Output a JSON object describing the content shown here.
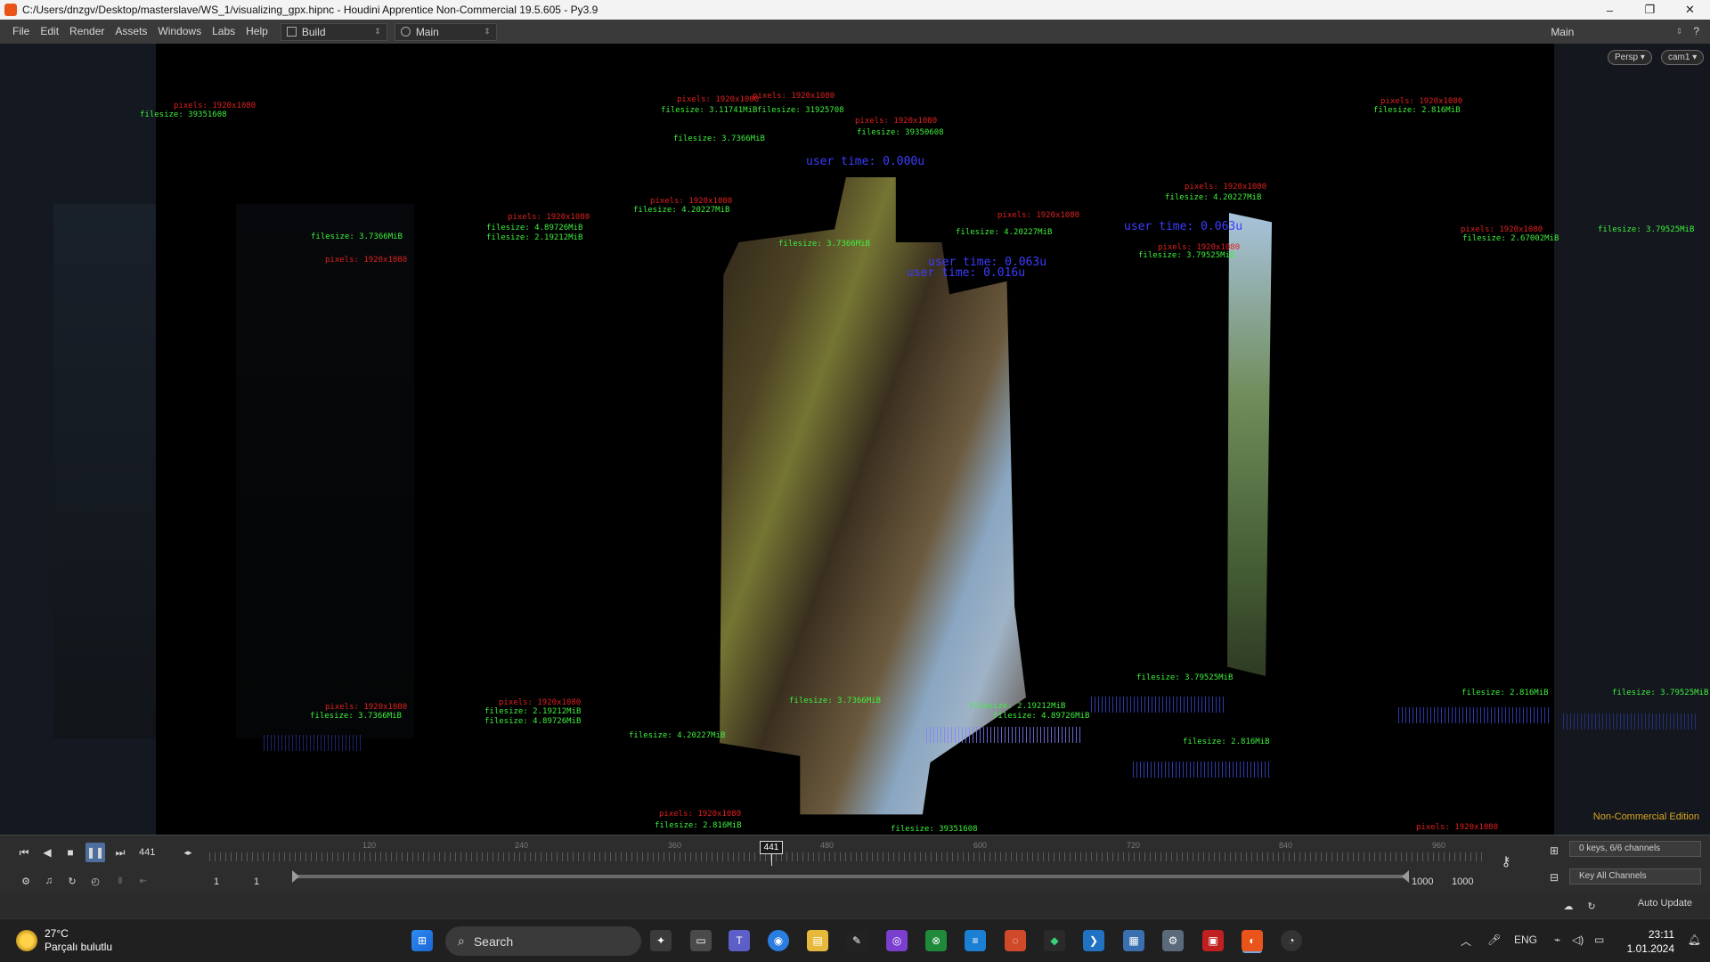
{
  "window": {
    "title": "C:/Users/dnzgv/Desktop/masterslave/WS_1/visualizing_gpx.hipnc - Houdini Apprentice Non-Commercial 19.5.605 - Py3.9",
    "minimize": "–",
    "maximize": "❐",
    "close": "✕"
  },
  "menu": {
    "items": [
      "File",
      "Edit",
      "Render",
      "Assets",
      "Windows",
      "Labs",
      "Help"
    ],
    "desktop_select": "Build",
    "desktop_select2": "Main",
    "right_desktop": "Main"
  },
  "viewport": {
    "persp_button": "Persp ▾",
    "cam_button": "cam1 ▾",
    "non_commercial": "Non-Commercial Edition",
    "labels_red": [
      "pixels: 1920x1080",
      "pixels: 1920x1080",
      "pixels: 1920x1080",
      "pixels: 1920x1080",
      "pixels: 1920x1080",
      "pixels: 1920x1080",
      "pixels: 1920x1080",
      "pixels: 1920x1080",
      "pixels: 1920x1080",
      "pixels: 1920x1080",
      "pixels: 1920x1080",
      "pixels: 1920x1080",
      "pixels: 1920x1080",
      "pixels: 1920x1080",
      "pixels: 1920x1080",
      "pixels: 1920x1080"
    ],
    "labels_green": [
      "filesize: 39351608",
      "filesize: 3.11741MiB",
      "filesize: 31925708",
      "filesize: 2.816MiB",
      "filesize: 3.7366MiB",
      "filesize: 4.89726MiB",
      "filesize: 2.19212MiB",
      "filesize: 4.20227MiB",
      "filesize: 3.7366MiB",
      "filesize: 39350608",
      "filesize: 2.816MiB",
      "filesize: 4.20227MiB",
      "filesize: 3.79525MiB",
      "filesize: 3.7366MiB",
      "filesize: 2.19212MiB",
      "filesize: 4.89726MiB",
      "filesize: 4.20227MiB",
      "filesize: 3.7366MiB",
      "filesize: 2.19212MiB",
      "filesize: 4.89726MiB",
      "filesize: 3.79525MiB",
      "filesize: 4.20227MiB",
      "filesize: 2.816MiB",
      "filesize: 39351608",
      "filesize: 3.79525MiB",
      "filesize: 2.67002MiB"
    ],
    "user_time_1": "user time: 0.063u",
    "user_time_2": "user time: 0.016u",
    "user_time_3": "user time: 0.000u",
    "user_time_4": "user time: 0.063u"
  },
  "playbar": {
    "frame": "441",
    "cursor_frame": "441",
    "tick_labels": [
      "120",
      "240",
      "360",
      "480",
      "600",
      "720",
      "840",
      "960"
    ],
    "range_start": "1",
    "range_start2": "1",
    "range_end": "1000",
    "range_end2": "1000",
    "keys_label": "0 keys, 6/6 channels",
    "key_all": "Key All Channels",
    "auto_update": "Auto Update"
  },
  "taskbar": {
    "temperature": "27°C",
    "weather": "Parçalı bulutlu",
    "search": "Search",
    "language": "ENG",
    "time": "23:11",
    "date": "1.01.2024"
  },
  "colors": {
    "accent": "#4e6e9e",
    "label_red": "#e02020",
    "label_green": "#3ef03e",
    "label_blue": "#2a2aff",
    "non_commercial": "#d8a51f"
  }
}
